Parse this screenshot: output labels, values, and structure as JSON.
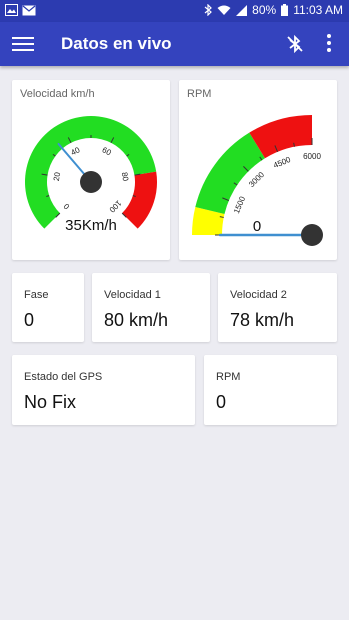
{
  "status_bar": {
    "battery": "80%",
    "time": "11:03 AM"
  },
  "app_bar": {
    "title": "Datos en vivo"
  },
  "speed_gauge": {
    "title": "Velocidad km/h",
    "min": 0,
    "max": 100,
    "ticks": [
      "0",
      "20",
      "40",
      "60",
      "80",
      "100"
    ],
    "zones": {
      "green_end": 80,
      "red_end": 100
    },
    "value": 35,
    "readout": "35Km/h"
  },
  "rpm_gauge": {
    "title": "RPM",
    "min": 0,
    "max": 6000,
    "ticks": [
      "1500",
      "3000",
      "4500",
      "6000"
    ],
    "zones": {
      "yellow_end": 900,
      "green_end": 3900,
      "red_end": 6000
    },
    "value": 0,
    "readout": "0"
  },
  "cards": {
    "fase": {
      "label": "Fase",
      "value": "0"
    },
    "velocidad1": {
      "label": "Velocidad 1",
      "value": "80 km/h"
    },
    "velocidad2": {
      "label": "Velocidad 2",
      "value": "78 km/h"
    },
    "gps": {
      "label": "Estado del GPS",
      "value": "No Fix"
    },
    "rpm": {
      "label": "RPM",
      "value": "0"
    }
  },
  "colors": {
    "primary": "#3443BE",
    "status_bar": "#2C3BB0",
    "gauge_green": "#22DD22",
    "gauge_red": "#EE1111",
    "gauge_yellow": "#FFFF00",
    "needle": "#3F8FD0"
  },
  "icons": {
    "menu": "menu-icon",
    "bluetooth_off": "bluetooth-disabled-icon",
    "more": "more-vert-icon"
  }
}
